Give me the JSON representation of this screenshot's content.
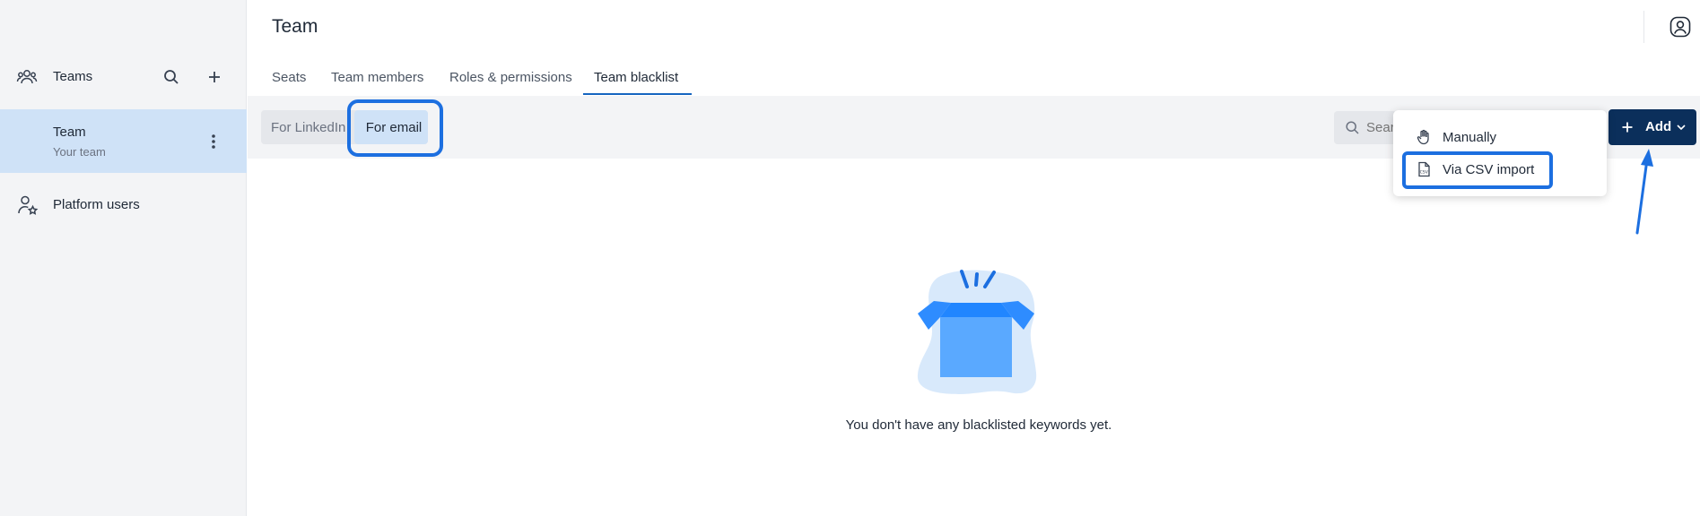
{
  "sidebar": {
    "teams_label": "Teams",
    "team_item": {
      "name": "Team",
      "subtitle": "Your team"
    },
    "platform_users_label": "Platform users"
  },
  "header": {
    "title": "Team"
  },
  "tabs": [
    {
      "label": "Seats",
      "active": false
    },
    {
      "label": "Team members",
      "active": false
    },
    {
      "label": "Roles & permissions",
      "active": false
    },
    {
      "label": "Team blacklist",
      "active": true
    }
  ],
  "toolbar": {
    "segments": [
      {
        "label": "For LinkedIn",
        "selected": false
      },
      {
        "label": "For email",
        "selected": true
      }
    ],
    "search_placeholder": "Search",
    "add_label": "Add"
  },
  "dropdown": {
    "items": [
      {
        "label": "Manually",
        "icon": "hand-icon"
      },
      {
        "label": "Via CSV import",
        "icon": "csv-file-icon"
      }
    ]
  },
  "empty_state": {
    "message": "You don't have any blacklisted keywords yet."
  },
  "colors": {
    "accent": "#1565c0",
    "primary_button": "#0b2f5b",
    "selected_bg": "#cfe2f7",
    "highlight": "#1c6fe0",
    "sidebar_bg": "#f3f4f6"
  }
}
